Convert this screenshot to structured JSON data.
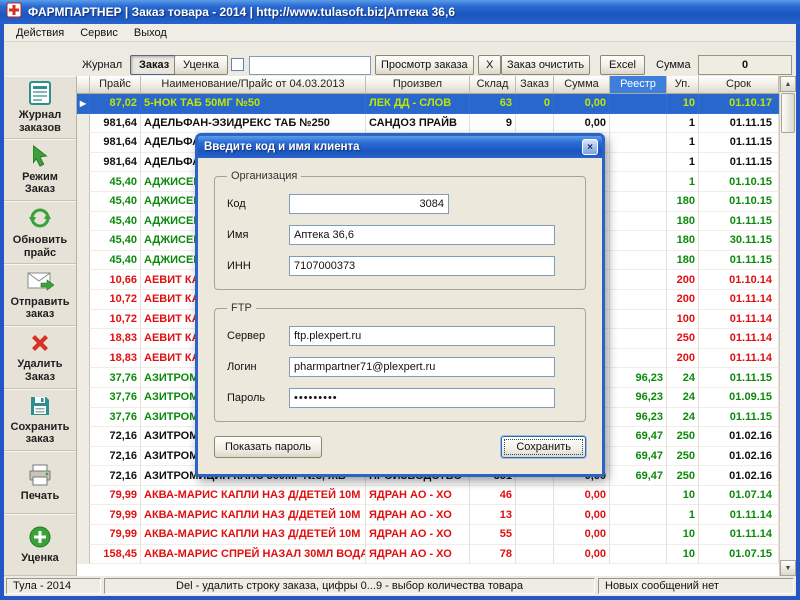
{
  "titlebar": {
    "title": "ФАРМПАРТНЕР  |  Заказ товара - 2014  |  http://www.tulasoft.biz|Аптека 36,6"
  },
  "menu": {
    "items": [
      {
        "id": "actions",
        "label": "Действия"
      },
      {
        "id": "service",
        "label": "Сервис"
      },
      {
        "id": "exit",
        "label": "Выход"
      }
    ]
  },
  "toolbar": {
    "journal": "Журнал",
    "order": "Заказ",
    "markdown": "Уценка",
    "search_value": "",
    "view_order": "Просмотр заказа",
    "clear_x": "X",
    "clear_order": "Заказ очистить",
    "excel": "Excel",
    "sum_label": "Сумма",
    "sum_value": "0"
  },
  "sidebar": {
    "items": [
      {
        "id": "journal",
        "label": "Журнал заказов",
        "icon": "journal-icon"
      },
      {
        "id": "order-mode",
        "label": "Режим Заказ",
        "icon": "cursor-icon"
      },
      {
        "id": "refresh-price",
        "label": "Обновить прайс",
        "icon": "refresh-icon"
      },
      {
        "id": "send-order",
        "label": "Отправить заказ",
        "icon": "send-mail-icon"
      },
      {
        "id": "delete-order",
        "label": "Удалить Заказ",
        "icon": "delete-icon"
      },
      {
        "id": "save-order",
        "label": "Сохранить заказ",
        "icon": "save-icon"
      },
      {
        "id": "print",
        "label": "Печать",
        "icon": "print-icon"
      },
      {
        "id": "markdown",
        "label": "Уценка",
        "icon": "add-icon"
      }
    ]
  },
  "table": {
    "marker_icon": "▶",
    "headers": [
      {
        "label": ""
      },
      {
        "label": "Прайс"
      },
      {
        "label": "Наименование/Прайс от 04.03.2013"
      },
      {
        "label": "Произвел"
      },
      {
        "label": "Склад"
      },
      {
        "label": "Заказ"
      },
      {
        "label": "Сумма"
      },
      {
        "label": "Реестр",
        "highlight": true
      },
      {
        "label": "Уп."
      },
      {
        "label": "Срок"
      }
    ],
    "rows": [
      {
        "price": "87,02",
        "name": "5-НОК ТАБ 50МГ №50",
        "producer": "ЛЕК ДД - СЛОВ",
        "stock": "63",
        "order": "0",
        "sum": "0,00",
        "registry": "",
        "pack": "10",
        "expiry": "01.10.17",
        "color": "selected"
      },
      {
        "price": "981,64",
        "name": "АДЕЛЬФАН-ЭЗИДРЕКС ТАБ №250",
        "producer": "САНДОЗ ПРАЙВ",
        "stock": "9",
        "sum": "0,00",
        "pack": "1",
        "expiry": "01.11.15",
        "color": "black"
      },
      {
        "price": "981,64",
        "name": "АДЕЛЬФА",
        "pack": "1",
        "expiry": "01.11.15",
        "color": "black"
      },
      {
        "price": "981,64",
        "name": "АДЕЛЬФА",
        "pack": "1",
        "expiry": "01.11.15",
        "color": "black"
      },
      {
        "price": "45,40",
        "name": "АДЖИСЕП",
        "pack": "1",
        "expiry": "01.10.15",
        "color": "green"
      },
      {
        "price": "45,40",
        "name": "АДЖИСЕП",
        "pack": "180",
        "expiry": "01.10.15",
        "color": "green"
      },
      {
        "price": "45,40",
        "name": "АДЖИСЕП",
        "pack": "180",
        "expiry": "01.11.15",
        "color": "green"
      },
      {
        "price": "45,40",
        "name": "АДЖИСЕП",
        "pack": "180",
        "expiry": "30.11.15",
        "color": "green"
      },
      {
        "price": "45,40",
        "name": "АДЖИСЕП",
        "pack": "180",
        "expiry": "01.11.15",
        "color": "green"
      },
      {
        "price": "10,66",
        "name": "АЕВИТ КАП",
        "pack": "200",
        "expiry": "01.10.14",
        "color": "red"
      },
      {
        "price": "10,72",
        "name": "АЕВИТ КАП",
        "pack": "200",
        "expiry": "01.11.14",
        "color": "red"
      },
      {
        "price": "10,72",
        "name": "АЕВИТ КАП",
        "pack": "100",
        "expiry": "01.11.14",
        "color": "red"
      },
      {
        "price": "18,83",
        "name": "АЕВИТ КАП",
        "pack": "250",
        "expiry": "01.11.14",
        "color": "red"
      },
      {
        "price": "18,83",
        "name": "АЕВИТ КАП",
        "pack": "200",
        "expiry": "01.11.14",
        "color": "red"
      },
      {
        "price": "37,76",
        "name": "АЗИТРОМ",
        "registry": "96,23",
        "pack": "24",
        "expiry": "01.11.15",
        "color": "green"
      },
      {
        "price": "37,76",
        "name": "АЗИТРОМ",
        "registry": "96,23",
        "pack": "24",
        "expiry": "01.09.15",
        "color": "green"
      },
      {
        "price": "37,76",
        "name": "АЗИТРОМ",
        "registry": "96,23",
        "pack": "24",
        "expiry": "01.11.15",
        "color": "green"
      },
      {
        "price": "72,16",
        "name": "АЗИТРОМ",
        "registry": "69,47",
        "pack": "250",
        "expiry": "01.02.16",
        "color": "black",
        "accents": {
          "registry": "green",
          "pack": "green"
        }
      },
      {
        "price": "72,16",
        "name": "АЗИТРОМ",
        "registry": "69,47",
        "pack": "250",
        "expiry": "01.02.16",
        "color": "black",
        "accents": {
          "registry": "green",
          "pack": "green"
        }
      },
      {
        "price": "72,16",
        "name": "АЗИТРОМИЦИН КАПС 500МГ №3, ЖВ",
        "producer": "ПРОИЗВОДСТВО",
        "stock": "351",
        "sum": "0,00",
        "registry": "69,47",
        "pack": "250",
        "expiry": "01.02.16",
        "color": "black",
        "accents": {
          "registry": "green",
          "pack": "green"
        }
      },
      {
        "price": "79,99",
        "name": "АКВА-МАРИС КАПЛИ НАЗ Д/ДЕТЕЙ 10М",
        "producer": "ЯДРАН АО - ХО",
        "stock": "46",
        "sum": "0,00",
        "pack": "10",
        "expiry": "01.07.14",
        "color": "red",
        "accents": {
          "pack": "green",
          "expiry": "green"
        }
      },
      {
        "price": "79,99",
        "name": "АКВА-МАРИС КАПЛИ НАЗ Д/ДЕТЕЙ 10М",
        "producer": "ЯДРАН АО - ХО",
        "stock": "13",
        "sum": "0,00",
        "pack": "1",
        "expiry": "01.11.14",
        "color": "red",
        "accents": {
          "pack": "green",
          "expiry": "green"
        }
      },
      {
        "price": "79,99",
        "name": "АКВА-МАРИС КАПЛИ НАЗ Д/ДЕТЕЙ 10М",
        "producer": "ЯДРАН АО - ХО",
        "stock": "55",
        "sum": "0,00",
        "pack": "10",
        "expiry": "01.11.14",
        "color": "red",
        "accents": {
          "pack": "green",
          "expiry": "green"
        }
      },
      {
        "price": "158,45",
        "name": "АКВА-МАРИС СПРЕЙ НАЗАЛ 30МЛ ВОДА",
        "producer": "ЯДРАН АО - ХО",
        "stock": "78",
        "sum": "0,00",
        "pack": "10",
        "expiry": "01.07.15",
        "color": "red",
        "accents": {
          "pack": "green",
          "expiry": "green"
        }
      }
    ]
  },
  "scrollbar": {
    "up": "▲",
    "down": "▼"
  },
  "dialog": {
    "title": "Введите код и имя клиента",
    "close_icon": "×",
    "org_group": {
      "legend": "Организация",
      "fields": [
        {
          "label": "Код",
          "value": "3084"
        },
        {
          "label": "Имя",
          "value": "Аптека 36,6"
        },
        {
          "label": "ИНН",
          "value": "7107000373"
        }
      ]
    },
    "ftp_group": {
      "legend": "FTP",
      "fields": [
        {
          "label": "Сервер",
          "value": "ftp.plexpert.ru"
        },
        {
          "label": "Логин",
          "value": "pharmpartner71@plexpert.ru"
        },
        {
          "label": "Пароль",
          "value": "•••••••••"
        }
      ]
    },
    "show_password_btn": "Показать пароль",
    "save_btn": "Сохранить"
  },
  "statusbar": {
    "left": "Тула - 2014",
    "center": "Del - удалить строку заказа,  цифры 0...9 - выбор количества товара",
    "right": "Новых сообщений нет"
  },
  "colors": {
    "titlebar": "#1C55C0",
    "selected_row_bg": "#2A67CC",
    "selected_row_text": "#BEE800",
    "green_row": "#0B8A0B",
    "red_row": "#E01010",
    "header_highlight": "#3E7EDC"
  }
}
